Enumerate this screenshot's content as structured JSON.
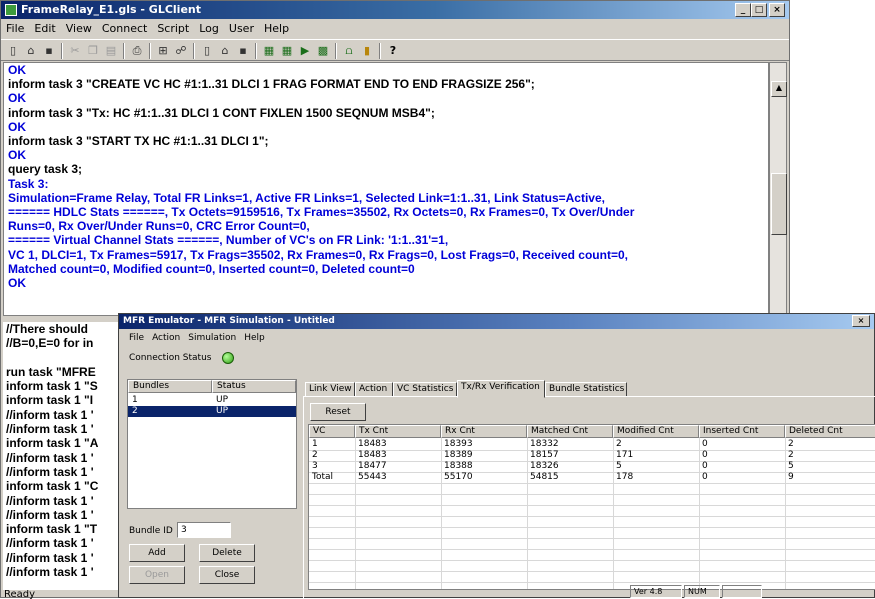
{
  "glclient": {
    "title": "FrameRelay_E1.gls - GLClient",
    "controls": [
      "_",
      "□",
      "×"
    ],
    "menu": [
      "File",
      "Edit",
      "View",
      "Connect",
      "Script",
      "Log",
      "User",
      "Help"
    ],
    "console_lines": [
      {
        "text": "OK",
        "color": "blue"
      },
      {
        "text": "inform task 3 \"CREATE VC HC #1:1..31 DLCI 1 FRAG FORMAT END TO END FRAGSIZE 256\";",
        "color": "black"
      },
      {
        "text": "OK",
        "color": "blue"
      },
      {
        "text": "inform task 3 \"Tx: HC #1:1..31 DLCI 1 CONT FIXLEN 1500 SEQNUM MSB4\";",
        "color": "black"
      },
      {
        "text": "OK",
        "color": "blue"
      },
      {
        "text": "inform task 3 \"START TX HC #1:1..31 DLCI 1\";",
        "color": "black"
      },
      {
        "text": "OK",
        "color": "blue"
      },
      {
        "text": "query task 3;",
        "color": "black"
      },
      {
        "text": "Task 3:",
        "color": "blue"
      },
      {
        "text": "Simulation=Frame Relay, Total FR Links=1, Active FR Links=1, Selected Link=1:1..31, Link Status=Active,",
        "color": "blue"
      },
      {
        "text": "====== HDLC Stats ======, Tx Octets=9159516, Tx Frames=35502, Rx Octets=0, Rx Frames=0, Tx Over/Under",
        "color": "blue"
      },
      {
        "text": "Runs=0, Rx Over/Under Runs=0, CRC Error Count=0,",
        "color": "blue"
      },
      {
        "text": "====== Virtual Channel Stats ======, Number of VC's on FR Link: '1:1..31'=1,",
        "color": "blue"
      },
      {
        "text": "VC 1, DLCI=1, Tx Frames=5917, Tx Frags=35502, Rx Frames=0, Rx Frags=0, Lost Frags=0,   Received count=0,",
        "color": "blue"
      },
      {
        "text": "Matched count=0,   Modified count=0,   Inserted count=0,   Deleted count=0",
        "color": "blue"
      },
      {
        "text": "OK",
        "color": "blue"
      }
    ],
    "lower_lines": [
      "//There should",
      "//B=0,E=0 for in",
      "",
      "run task \"MFRE",
      "inform task 1 \"S",
      "inform task 1 \"I",
      "//inform task 1 '",
      "//inform task 1 '",
      "inform task 1 \"A",
      "//inform task 1 '",
      "//inform task 1 '",
      "inform task 1 \"C",
      "//inform task 1 '",
      "//inform task 1 '",
      "inform task 1 \"T",
      "//inform task 1 '",
      "//inform task 1 '",
      "//inform task 1 '"
    ],
    "status": "Ready"
  },
  "mfr": {
    "title": "MFR Emulator - MFR Simulation - Untitled",
    "close": "×",
    "menu": [
      "File",
      "Action",
      "Simulation",
      "Help"
    ],
    "connection_status_label": "Connection Status",
    "bundles": {
      "headers": [
        "Bundles",
        "Status"
      ],
      "rows": [
        {
          "id": "1",
          "status": "UP"
        },
        {
          "id": "2",
          "status": "UP"
        }
      ]
    },
    "bundle_id_label": "Bundle ID",
    "bundle_id_value": "3",
    "buttons": {
      "add": "Add",
      "delete": "Delete",
      "open": "Open",
      "close": "Close"
    },
    "tabs": [
      "Link View",
      "Action",
      "VC Statistics",
      "Tx/Rx Verification",
      "Bundle Statistics"
    ],
    "active_tab": 3,
    "reset_label": "Reset",
    "table": {
      "columns": [
        "VC",
        "Tx Cnt",
        "Rx Cnt",
        "Matched Cnt",
        "Modified Cnt",
        "Inserted Cnt",
        "Deleted Cnt"
      ],
      "rows": [
        [
          "1",
          "18483",
          "18393",
          "18332",
          "2",
          "0",
          "2"
        ],
        [
          "2",
          "18483",
          "18389",
          "18157",
          "171",
          "0",
          "2"
        ],
        [
          "3",
          "18477",
          "18388",
          "18326",
          "5",
          "0",
          "5"
        ],
        [
          "Total",
          "55443",
          "55170",
          "54815",
          "178",
          "0",
          "9"
        ]
      ]
    },
    "status_panels": [
      "Ver 4.8",
      "NUM"
    ]
  }
}
